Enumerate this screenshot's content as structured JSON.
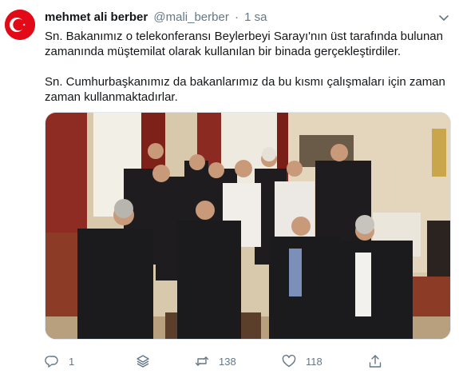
{
  "tweet": {
    "display_name": "mehmet ali berber",
    "handle": "@mali_berber",
    "separator": "·",
    "time": "1 sa",
    "paragraphs": [
      "Sn. Bakanımız o telekonferansı Beylerbeyi Sarayı'nın üst tarafında bulunan zamanında müştemilat olarak kullanılan bir binada gerçekleştirdiler.",
      "Sn. Cumhurbaşkanımız da bakanlarımız da bu kısmı çalışmaları için zaman zaman kullanmaktadırlar."
    ],
    "avatar": {
      "icon": "turkish-flag-icon",
      "color": "#e30a17"
    },
    "menu_icon": "chevron-down-icon"
  },
  "actions": {
    "reply": {
      "icon": "reply-icon",
      "count": "1"
    },
    "layers": {
      "icon": "layers-icon"
    },
    "retweet": {
      "icon": "retweet-icon",
      "count": "138"
    },
    "like": {
      "icon": "heart-icon",
      "count": "118"
    },
    "share": {
      "icon": "share-icon"
    }
  },
  "colors": {
    "text": "#14171a",
    "secondary": "#657786",
    "border": "#e1e8ed"
  }
}
